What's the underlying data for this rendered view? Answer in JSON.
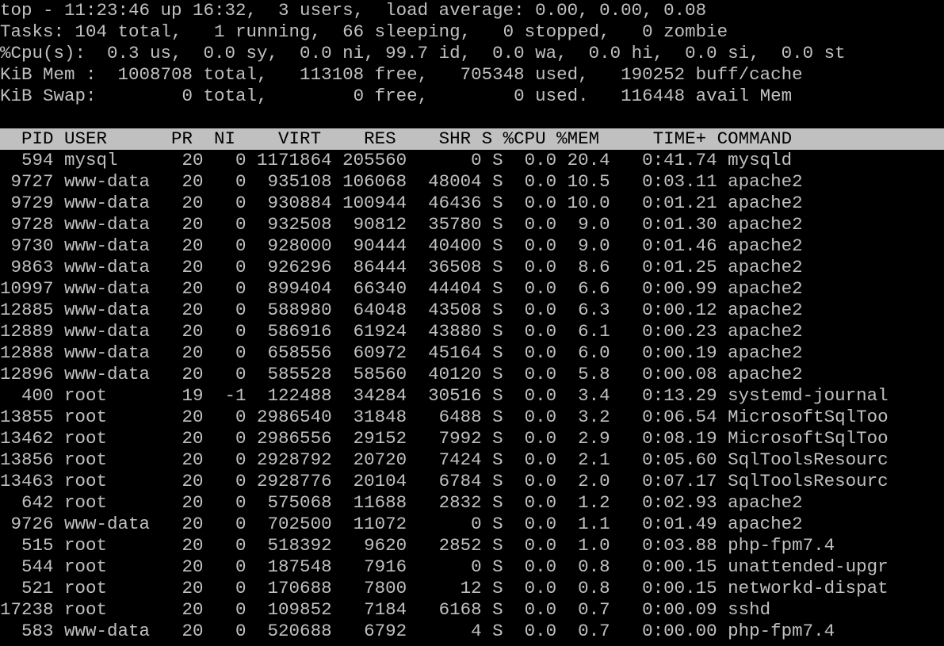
{
  "colors": {
    "background": "#000000",
    "foreground": "#c0c0c0",
    "header_background": "#c0c0c0",
    "header_foreground": "#000000"
  },
  "summary": {
    "uptime_line": "top - 11:23:46 up 16:32,  3 users,  load average: 0.00, 0.00, 0.08",
    "tasks_line": "Tasks: 104 total,   1 running,  66 sleeping,   0 stopped,   0 zombie",
    "cpu_line": "%Cpu(s):  0.3 us,  0.0 sy,  0.0 ni, 99.7 id,  0.0 wa,  0.0 hi,  0.0 si,  0.0 st",
    "mem_line": "KiB Mem :  1008708 total,   113108 free,   705348 used,   190252 buff/cache",
    "swap_line": "KiB Swap:        0 total,        0 free,        0 used.   116448 avail Mem"
  },
  "columns": {
    "header_line": "  PID USER      PR  NI    VIRT    RES    SHR S %CPU %MEM     TIME+ COMMAND",
    "names": [
      "PID",
      "USER",
      "PR",
      "NI",
      "VIRT",
      "RES",
      "SHR",
      "S",
      "%CPU",
      "%MEM",
      "TIME+",
      "COMMAND"
    ]
  },
  "processes": [
    {
      "pid": "594",
      "user": "mysql",
      "pr": "20",
      "ni": "0",
      "virt": "1171864",
      "res": "205560",
      "shr": "0",
      "s": "S",
      "cpu": "0.0",
      "mem": "20.4",
      "time": "0:41.74",
      "command": "mysqld"
    },
    {
      "pid": "9727",
      "user": "www-data",
      "pr": "20",
      "ni": "0",
      "virt": "935108",
      "res": "106068",
      "shr": "48004",
      "s": "S",
      "cpu": "0.0",
      "mem": "10.5",
      "time": "0:03.11",
      "command": "apache2"
    },
    {
      "pid": "9729",
      "user": "www-data",
      "pr": "20",
      "ni": "0",
      "virt": "930884",
      "res": "100944",
      "shr": "46436",
      "s": "S",
      "cpu": "0.0",
      "mem": "10.0",
      "time": "0:01.21",
      "command": "apache2"
    },
    {
      "pid": "9728",
      "user": "www-data",
      "pr": "20",
      "ni": "0",
      "virt": "932508",
      "res": "90812",
      "shr": "35780",
      "s": "S",
      "cpu": "0.0",
      "mem": "9.0",
      "time": "0:01.30",
      "command": "apache2"
    },
    {
      "pid": "9730",
      "user": "www-data",
      "pr": "20",
      "ni": "0",
      "virt": "928000",
      "res": "90444",
      "shr": "40400",
      "s": "S",
      "cpu": "0.0",
      "mem": "9.0",
      "time": "0:01.46",
      "command": "apache2"
    },
    {
      "pid": "9863",
      "user": "www-data",
      "pr": "20",
      "ni": "0",
      "virt": "926296",
      "res": "86444",
      "shr": "36508",
      "s": "S",
      "cpu": "0.0",
      "mem": "8.6",
      "time": "0:01.25",
      "command": "apache2"
    },
    {
      "pid": "10997",
      "user": "www-data",
      "pr": "20",
      "ni": "0",
      "virt": "899404",
      "res": "66340",
      "shr": "44404",
      "s": "S",
      "cpu": "0.0",
      "mem": "6.6",
      "time": "0:00.99",
      "command": "apache2"
    },
    {
      "pid": "12885",
      "user": "www-data",
      "pr": "20",
      "ni": "0",
      "virt": "588980",
      "res": "64048",
      "shr": "43508",
      "s": "S",
      "cpu": "0.0",
      "mem": "6.3",
      "time": "0:00.12",
      "command": "apache2"
    },
    {
      "pid": "12889",
      "user": "www-data",
      "pr": "20",
      "ni": "0",
      "virt": "586916",
      "res": "61924",
      "shr": "43880",
      "s": "S",
      "cpu": "0.0",
      "mem": "6.1",
      "time": "0:00.23",
      "command": "apache2"
    },
    {
      "pid": "12888",
      "user": "www-data",
      "pr": "20",
      "ni": "0",
      "virt": "658556",
      "res": "60972",
      "shr": "45164",
      "s": "S",
      "cpu": "0.0",
      "mem": "6.0",
      "time": "0:00.19",
      "command": "apache2"
    },
    {
      "pid": "12896",
      "user": "www-data",
      "pr": "20",
      "ni": "0",
      "virt": "585528",
      "res": "58560",
      "shr": "40120",
      "s": "S",
      "cpu": "0.0",
      "mem": "5.8",
      "time": "0:00.08",
      "command": "apache2"
    },
    {
      "pid": "400",
      "user": "root",
      "pr": "19",
      "ni": "-1",
      "virt": "122488",
      "res": "34284",
      "shr": "30516",
      "s": "S",
      "cpu": "0.0",
      "mem": "3.4",
      "time": "0:13.29",
      "command": "systemd-journal"
    },
    {
      "pid": "13855",
      "user": "root",
      "pr": "20",
      "ni": "0",
      "virt": "2986540",
      "res": "31848",
      "shr": "6488",
      "s": "S",
      "cpu": "0.0",
      "mem": "3.2",
      "time": "0:06.54",
      "command": "MicrosoftSqlToo"
    },
    {
      "pid": "13462",
      "user": "root",
      "pr": "20",
      "ni": "0",
      "virt": "2986556",
      "res": "29152",
      "shr": "7992",
      "s": "S",
      "cpu": "0.0",
      "mem": "2.9",
      "time": "0:08.19",
      "command": "MicrosoftSqlToo"
    },
    {
      "pid": "13856",
      "user": "root",
      "pr": "20",
      "ni": "0",
      "virt": "2928792",
      "res": "20720",
      "shr": "7424",
      "s": "S",
      "cpu": "0.0",
      "mem": "2.1",
      "time": "0:05.60",
      "command": "SqlToolsResourc"
    },
    {
      "pid": "13463",
      "user": "root",
      "pr": "20",
      "ni": "0",
      "virt": "2928776",
      "res": "20104",
      "shr": "6784",
      "s": "S",
      "cpu": "0.0",
      "mem": "2.0",
      "time": "0:07.17",
      "command": "SqlToolsResourc"
    },
    {
      "pid": "642",
      "user": "root",
      "pr": "20",
      "ni": "0",
      "virt": "575068",
      "res": "11688",
      "shr": "2832",
      "s": "S",
      "cpu": "0.0",
      "mem": "1.2",
      "time": "0:02.93",
      "command": "apache2"
    },
    {
      "pid": "9726",
      "user": "www-data",
      "pr": "20",
      "ni": "0",
      "virt": "702500",
      "res": "11072",
      "shr": "0",
      "s": "S",
      "cpu": "0.0",
      "mem": "1.1",
      "time": "0:01.49",
      "command": "apache2"
    },
    {
      "pid": "515",
      "user": "root",
      "pr": "20",
      "ni": "0",
      "virt": "518392",
      "res": "9620",
      "shr": "2852",
      "s": "S",
      "cpu": "0.0",
      "mem": "1.0",
      "time": "0:03.88",
      "command": "php-fpm7.4"
    },
    {
      "pid": "544",
      "user": "root",
      "pr": "20",
      "ni": "0",
      "virt": "187548",
      "res": "7916",
      "shr": "0",
      "s": "S",
      "cpu": "0.0",
      "mem": "0.8",
      "time": "0:00.15",
      "command": "unattended-upgr"
    },
    {
      "pid": "521",
      "user": "root",
      "pr": "20",
      "ni": "0",
      "virt": "170688",
      "res": "7800",
      "shr": "12",
      "s": "S",
      "cpu": "0.0",
      "mem": "0.8",
      "time": "0:00.15",
      "command": "networkd-dispat"
    },
    {
      "pid": "17238",
      "user": "root",
      "pr": "20",
      "ni": "0",
      "virt": "109852",
      "res": "7184",
      "shr": "6168",
      "s": "S",
      "cpu": "0.0",
      "mem": "0.7",
      "time": "0:00.09",
      "command": "sshd"
    },
    {
      "pid": "583",
      "user": "www-data",
      "pr": "20",
      "ni": "0",
      "virt": "520688",
      "res": "6792",
      "shr": "4",
      "s": "S",
      "cpu": "0.0",
      "mem": "0.7",
      "time": "0:00.00",
      "command": "php-fpm7.4"
    }
  ]
}
